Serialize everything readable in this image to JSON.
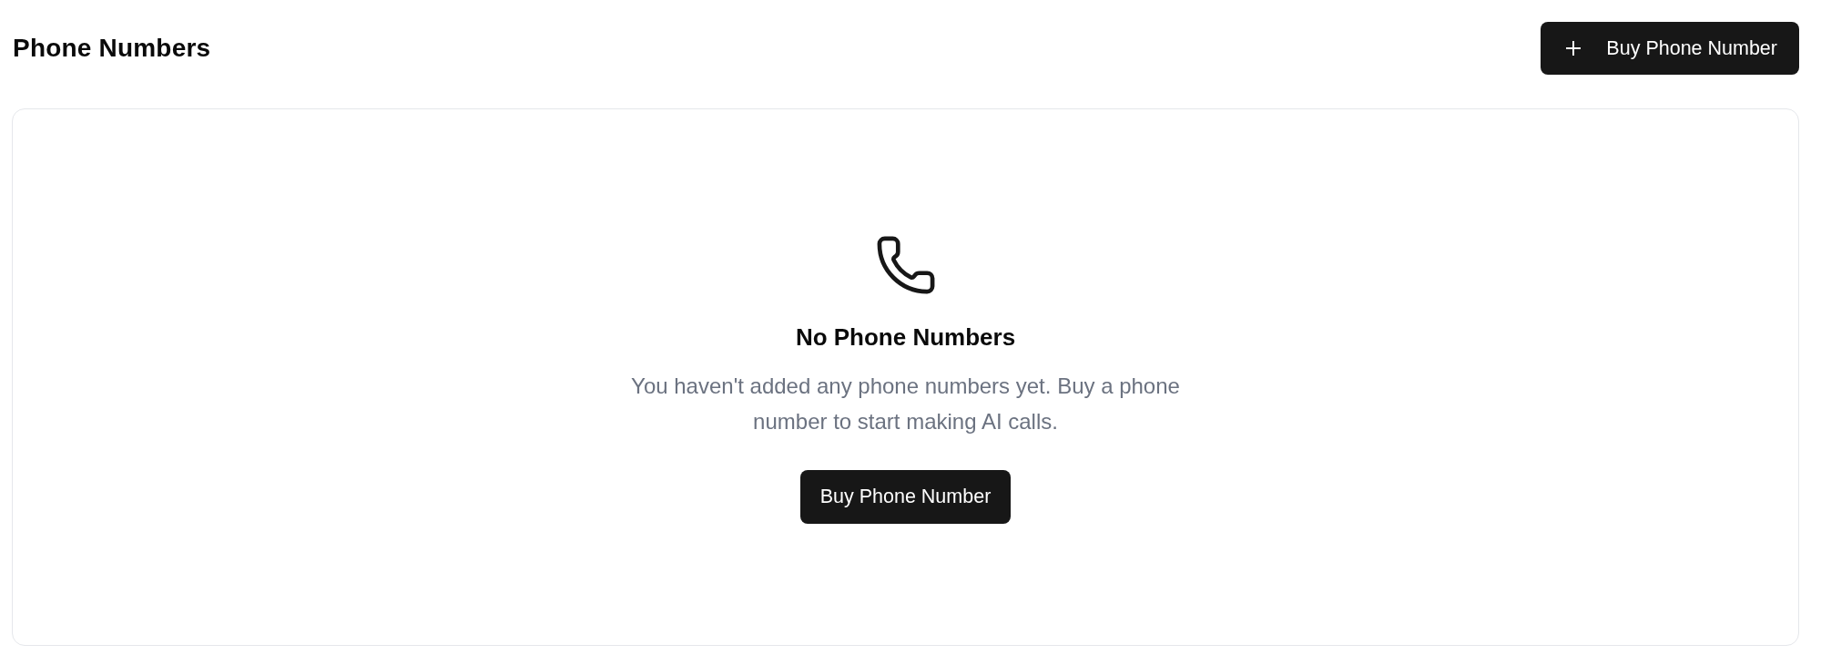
{
  "header": {
    "title": "Phone Numbers",
    "action": {
      "label": "Buy Phone Number"
    }
  },
  "empty_state": {
    "title": "No Phone Numbers",
    "message": "You haven't added any phone numbers yet. Buy a phone number to start making AI calls.",
    "action": {
      "label": "Buy Phone Number"
    }
  }
}
